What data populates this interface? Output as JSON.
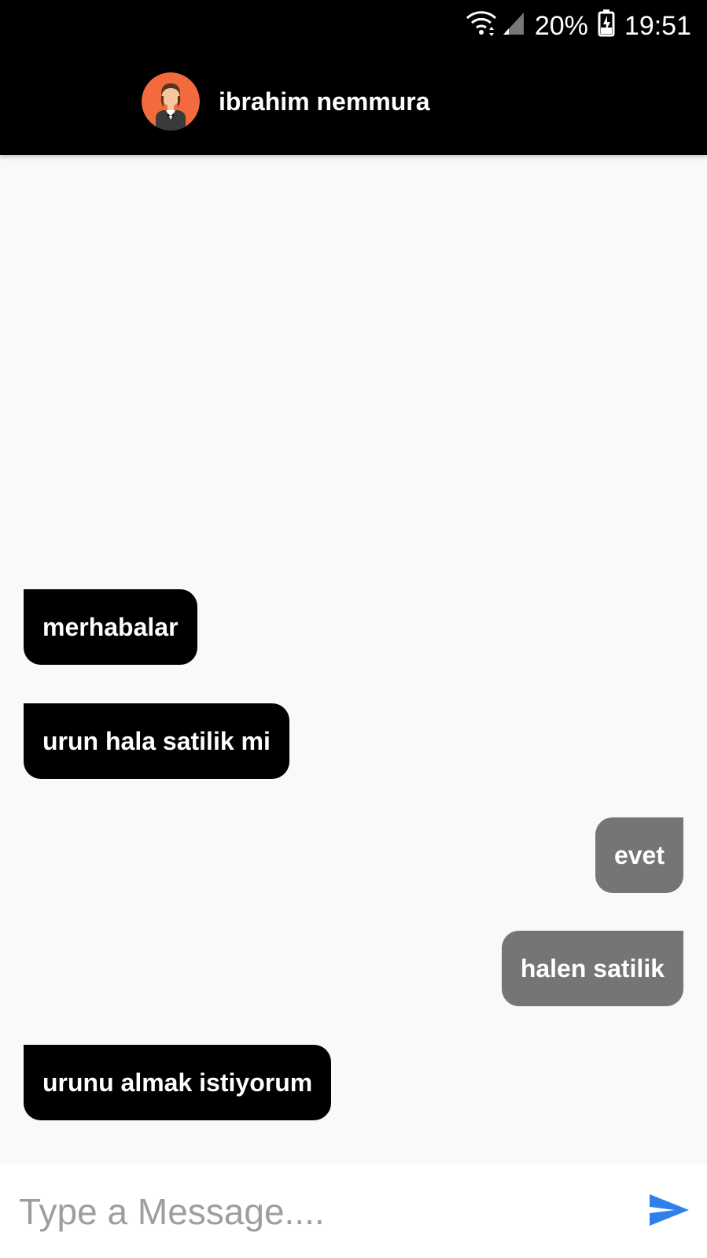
{
  "status_bar": {
    "battery": "20%",
    "time": "19:51",
    "icons": [
      "wifi-icon",
      "signal-icon",
      "battery-charging-icon"
    ]
  },
  "toolbar": {
    "contact_name": "ibrahim nemmura",
    "avatar_icon": "user-avatar-icon"
  },
  "messages": [
    {
      "text": "merhabalar",
      "direction": "incoming"
    },
    {
      "text": "urun hala satilik mi",
      "direction": "incoming"
    },
    {
      "text": "evet",
      "direction": "outgoing"
    },
    {
      "text": "halen satilik",
      "direction": "outgoing"
    },
    {
      "text": "urunu almak istiyorum",
      "direction": "incoming"
    }
  ],
  "composer": {
    "placeholder": "Type a Message....",
    "value": "",
    "send_icon": "send-icon"
  },
  "colors": {
    "header_bg": "#000000",
    "incoming_bubble": "#000000",
    "outgoing_bubble": "#757575",
    "chat_bg": "#f9f9f9",
    "send_accent": "#2f80ed",
    "avatar_bg": "#f26a3d"
  }
}
